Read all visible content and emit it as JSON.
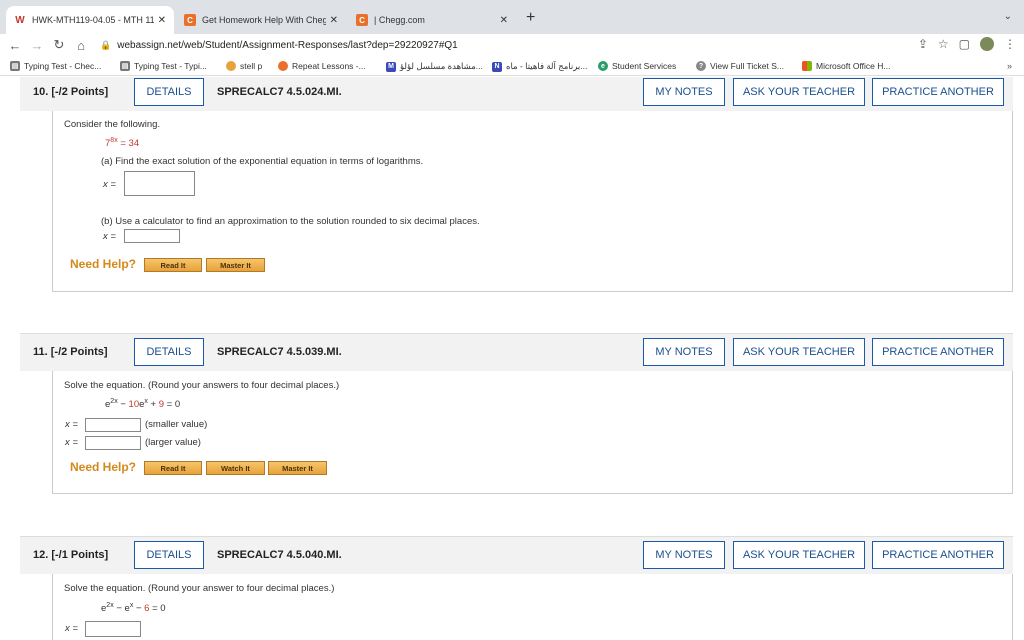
{
  "tabs": [
    {
      "title": "HWK-MTH119-04.05 - MTH 11",
      "icon": "webassign-icon"
    },
    {
      "title": "Get Homework Help With Chegg",
      "icon": "chegg-icon"
    },
    {
      "title": "| Chegg.com",
      "icon": "chegg-icon"
    }
  ],
  "address": {
    "url": "webassign.net/web/Student/Assignment-Responses/last?dep=29220927#Q1"
  },
  "bookmarks": [
    {
      "label": "Typing Test - Chec..."
    },
    {
      "label": "Typing Test - Typi..."
    },
    {
      "label": "stell p"
    },
    {
      "label": "Repeat Lessons -..."
    },
    {
      "label": "مشاهدة مسلسل لؤلؤ..."
    },
    {
      "label": "برنامج آلة فاهيتا - ماه..."
    },
    {
      "label": "Student Services"
    },
    {
      "label": "View Full Ticket S..."
    },
    {
      "label": "Microsoft Office H..."
    }
  ],
  "buttons": {
    "details": "DETAILS",
    "my_notes": "MY NOTES",
    "ask_teacher": "ASK YOUR TEACHER",
    "practice": "PRACTICE ANOTHER",
    "need_help": "Need Help?",
    "read_it": "Read It",
    "master_it": "Master It",
    "watch_it": "Watch It"
  },
  "questions": [
    {
      "number": "10.",
      "points": "[-/2 Points]",
      "code": "SPRECALC7 4.5.024.MI.",
      "intro": "Consider the following.",
      "equation": {
        "base": "7",
        "exp": "8x",
        "rhs": "= 34"
      },
      "part_a": "(a) Find the exact solution of the exponential equation in terms of logarithms.",
      "part_b": "(b) Use a calculator to find an approximation to the solution rounded to six decimal places.",
      "var_label": "x ="
    },
    {
      "number": "11.",
      "points": "[-/2 Points]",
      "code": "SPRECALC7 4.5.039.MI.",
      "intro": "Solve the equation. (Round your answers to four decimal places.)",
      "equation": {
        "t1": "e",
        "t1exp": "2x",
        "t2": " − ",
        "t3": "10",
        "t4": "e",
        "t4exp": "x",
        "t5": " + ",
        "t6": "9",
        "t7": " = 0"
      },
      "var_label": "x =",
      "smaller": "(smaller value)",
      "larger": "(larger value)"
    },
    {
      "number": "12.",
      "points": "[-/1 Points]",
      "code": "SPRECALC7 4.5.040.MI.",
      "intro": "Solve the equation. (Round your answer to four decimal places.)",
      "equation": {
        "t1": "e",
        "t1exp": "2x",
        "t2": " − e",
        "t2exp": "x",
        "t3": " − ",
        "t4": "6",
        "t5": " = 0"
      },
      "var_label": "x ="
    }
  ]
}
